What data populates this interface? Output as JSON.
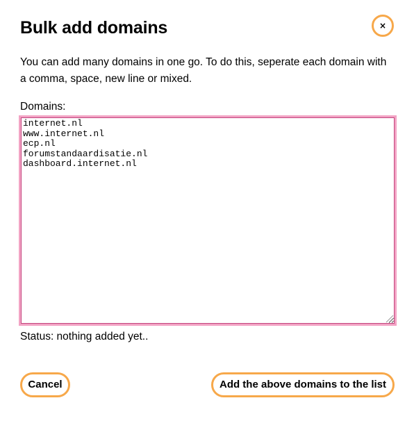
{
  "dialog": {
    "title": "Bulk add domains",
    "close_label": "×",
    "close_icon": "close-icon",
    "description": "You can add many domains in one go. To do this, seperate each domain with a comma, space, new line or mixed.",
    "domains_label": "Domains:",
    "domains_value": "internet.nl\nwww.internet.nl\necp.nl\nforumstandaardisatie.nl\ndashboard.internet.nl\n",
    "status": "Status: nothing added yet..",
    "cancel_label": "Cancel",
    "add_label": "Add the above domains to the list"
  },
  "colors": {
    "button_border": "#f7a84a",
    "textarea_focus_border": "#f2a3c4",
    "textarea_focus_inner": "#c3447d",
    "spellcheck_underline": "#d0021b"
  }
}
